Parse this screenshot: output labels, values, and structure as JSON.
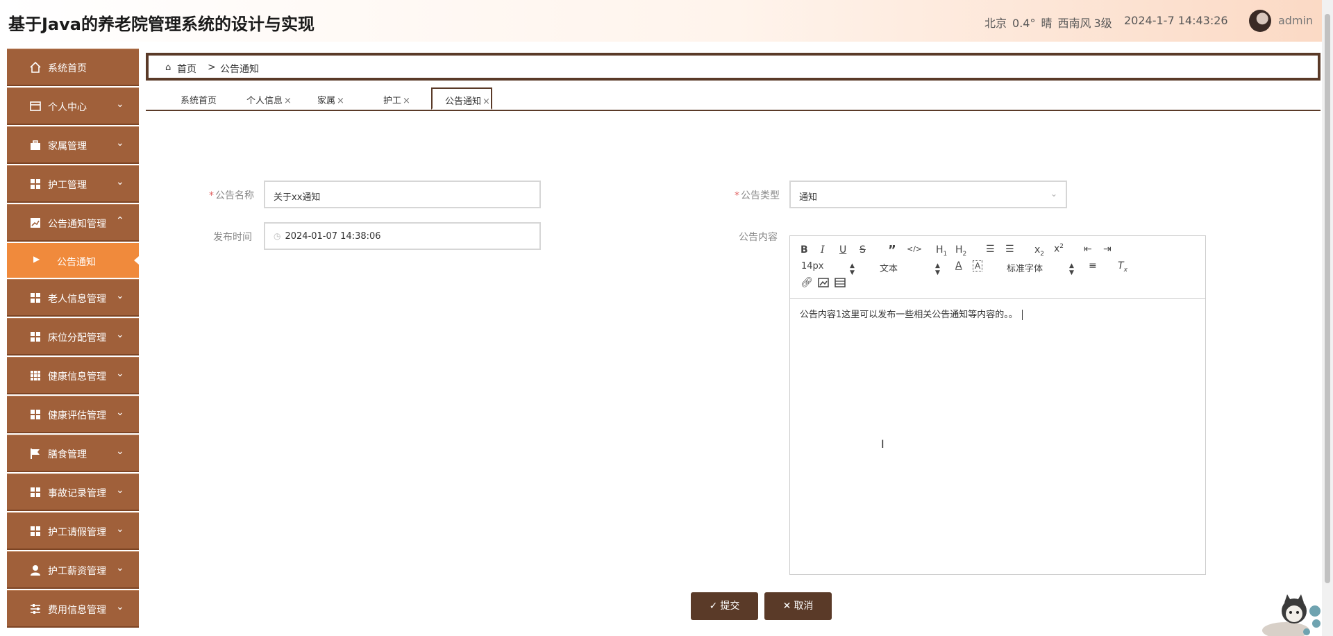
{
  "header": {
    "title": "基于Java的养老院管理系统的设计与实现",
    "city": "北京",
    "temperature": "0.4°",
    "weather": "晴",
    "wind": "西南风",
    "wind_level": "3级",
    "datetime": "2024-1-7 14:43:26",
    "username": "admin"
  },
  "sidebar": {
    "items": [
      {
        "label": "系统首页",
        "icon": "home-icon"
      },
      {
        "label": "个人中心",
        "icon": "card-icon"
      },
      {
        "label": "家属管理",
        "icon": "briefcase-icon"
      },
      {
        "label": "护工管理",
        "icon": "grid-icon"
      },
      {
        "label": "公告通知管理",
        "icon": "chart-icon"
      },
      {
        "label": "公告通知",
        "sub": true
      },
      {
        "label": "老人信息管理",
        "icon": "grid-icon"
      },
      {
        "label": "床位分配管理",
        "icon": "grid-icon"
      },
      {
        "label": "健康信息管理",
        "icon": "table-icon"
      },
      {
        "label": "健康评估管理",
        "icon": "grid-icon"
      },
      {
        "label": "膳食管理",
        "icon": "flag-icon"
      },
      {
        "label": "事故记录管理",
        "icon": "grid-icon"
      },
      {
        "label": "护工请假管理",
        "icon": "grid-icon"
      },
      {
        "label": "护工薪资管理",
        "icon": "user-icon"
      },
      {
        "label": "费用信息管理",
        "icon": "sliders-icon"
      }
    ]
  },
  "breadcrumb": {
    "home": "首页",
    "separator": ">",
    "current": "公告通知"
  },
  "tabs": [
    {
      "label": "系统首页",
      "closable": false
    },
    {
      "label": "个人信息",
      "closable": true
    },
    {
      "label": "家属",
      "closable": true
    },
    {
      "label": "护工",
      "closable": true
    },
    {
      "label": "公告通知",
      "closable": true,
      "active": true
    }
  ],
  "tab_close_glyph": "×",
  "form": {
    "name_label": "公告名称",
    "name_value": "关于xx通知",
    "type_label": "公告类型",
    "type_value": "通知",
    "time_label": "发布时间",
    "time_value": "2024-01-07 14:38:06",
    "content_label": "公告内容",
    "required_mark": "*"
  },
  "editor": {
    "font_size": "14px",
    "block_format": "文本",
    "font_family": "标准字体",
    "content": "公告内容1这里可以发布一些相关公告通知等内容的。。"
  },
  "buttons": {
    "submit": "提交",
    "cancel": "取消"
  },
  "colors": {
    "sidebar_bg": "#a0603a",
    "sidebar_active": "#f08a3c",
    "accent_dark": "#5a3a28"
  }
}
